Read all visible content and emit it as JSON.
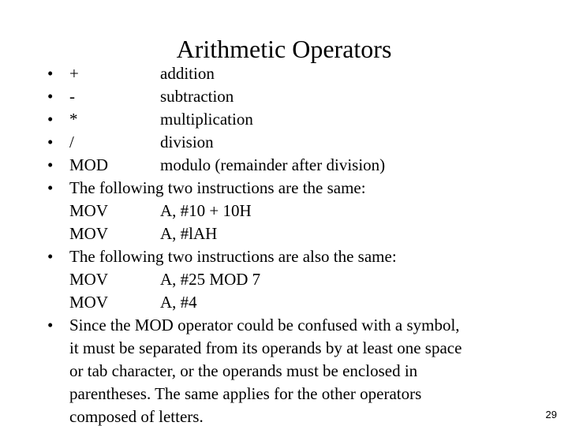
{
  "slide": {
    "title": "Arithmetic Operators",
    "page_number": "29",
    "bullet_glyph": "•",
    "text_color": "#000000",
    "background_color": "#ffffff"
  },
  "operators": [
    {
      "symbol": "+",
      "description": "addition"
    },
    {
      "symbol": "-",
      "description": "subtraction"
    },
    {
      "symbol": "*",
      "description": "multiplication"
    },
    {
      "symbol": "/",
      "description": "division"
    },
    {
      "symbol": "MOD",
      "description": "modulo (remainder after division)"
    }
  ],
  "example_one": {
    "heading": "The following two instructions are the same:",
    "lines": [
      {
        "mnemonic": "MOV",
        "operands": "A, #10 + 10H"
      },
      {
        "mnemonic": "MOV",
        "operands": "A, #lAH"
      }
    ]
  },
  "example_two": {
    "heading": "The following two instructions are also the same:",
    "lines": [
      {
        "mnemonic": "MOV",
        "operands": "A, #25 MOD 7"
      },
      {
        "mnemonic": "MOV",
        "operands": "A, #4"
      }
    ]
  },
  "note": {
    "lines": [
      "Since the MOD operator could be confused with a symbol,",
      "it must be separated from its operands by at least one space",
      "or tab character, or the operands must be enclosed in",
      "parentheses. The same applies for the other operators",
      "composed of letters."
    ]
  }
}
